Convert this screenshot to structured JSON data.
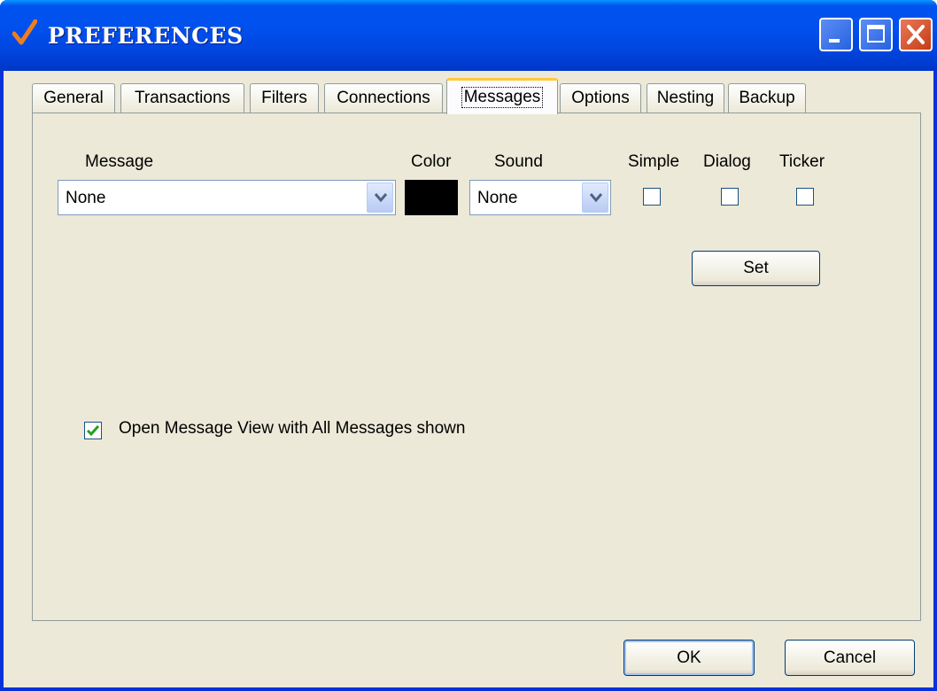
{
  "window": {
    "title": "PREFERENCES"
  },
  "tabs": [
    {
      "label": "General"
    },
    {
      "label": "Transactions"
    },
    {
      "label": "Filters"
    },
    {
      "label": "Connections"
    },
    {
      "label": "Messages",
      "active": true
    },
    {
      "label": "Options"
    },
    {
      "label": "Nesting"
    },
    {
      "label": "Backup"
    }
  ],
  "messages_tab": {
    "headers": {
      "message": "Message",
      "color": "Color",
      "sound": "Sound",
      "simple": "Simple",
      "dialog": "Dialog",
      "ticker": "Ticker"
    },
    "message_select": {
      "value": "None"
    },
    "color_swatch": {
      "color": "#000000"
    },
    "sound_select": {
      "value": "None"
    },
    "simple_checked": false,
    "dialog_checked": false,
    "ticker_checked": false,
    "set_button": "Set",
    "open_message_view": {
      "label": "Open Message View with All Messages shown",
      "checked": true
    }
  },
  "footer": {
    "ok": "OK",
    "cancel": "Cancel"
  },
  "colors": {
    "titlebar": "#0053ee",
    "face": "#ece9d8",
    "accent_check": "#f07d1c",
    "checkmark": "#21a121"
  }
}
